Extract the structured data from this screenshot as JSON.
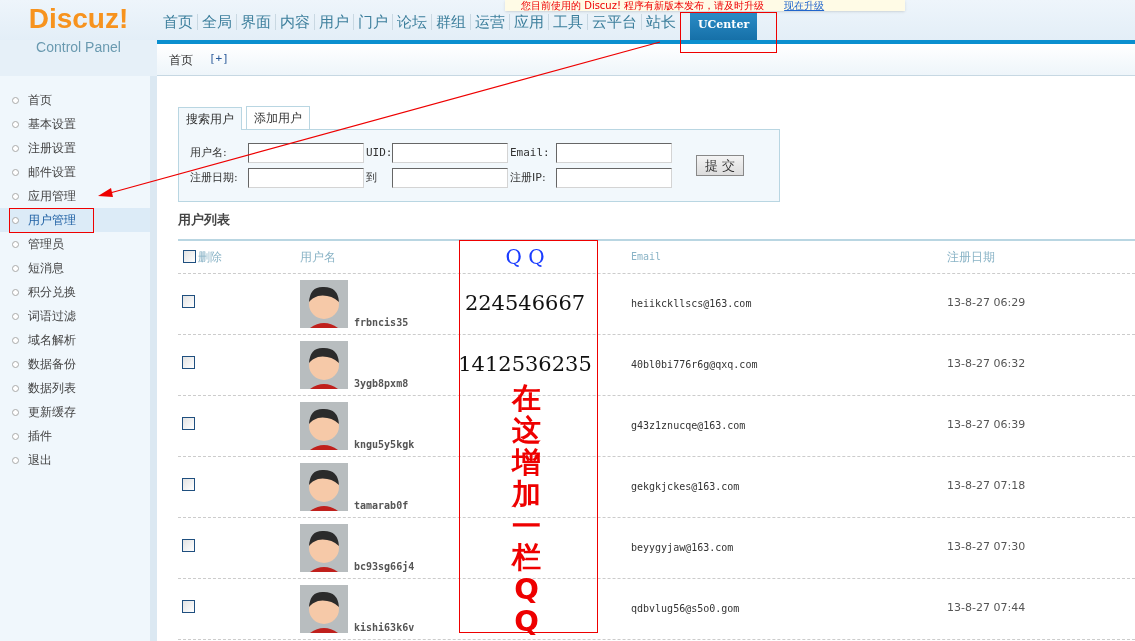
{
  "logo": {
    "title": "Discuz!",
    "subtitle": "Control Panel"
  },
  "notice": {
    "text": "您目前使用的 Discuz! 程序有新版本发布，请及时升级",
    "link": "现在升级"
  },
  "top_nav": [
    {
      "label": "首页",
      "selected": false
    },
    {
      "label": "全局",
      "selected": false
    },
    {
      "label": "界面",
      "selected": false
    },
    {
      "label": "内容",
      "selected": false
    },
    {
      "label": "用户",
      "selected": false
    },
    {
      "label": "门户",
      "selected": false
    },
    {
      "label": "论坛",
      "selected": false
    },
    {
      "label": "群组",
      "selected": false
    },
    {
      "label": "运营",
      "selected": false
    },
    {
      "label": "应用",
      "selected": false
    },
    {
      "label": "工具",
      "selected": false
    },
    {
      "label": "云平台",
      "selected": false
    },
    {
      "label": "站长",
      "selected": false
    },
    {
      "label": "UCenter",
      "selected": true
    }
  ],
  "breadcrumb": {
    "home": "首页",
    "add": "[+]"
  },
  "sidebar": {
    "items": [
      {
        "label": "首页",
        "selected": false
      },
      {
        "label": "基本设置",
        "selected": false
      },
      {
        "label": "注册设置",
        "selected": false
      },
      {
        "label": "邮件设置",
        "selected": false
      },
      {
        "label": "应用管理",
        "selected": false
      },
      {
        "label": "用户管理",
        "selected": true
      },
      {
        "label": "管理员",
        "selected": false
      },
      {
        "label": "短消息",
        "selected": false
      },
      {
        "label": "积分兑换",
        "selected": false
      },
      {
        "label": "词语过滤",
        "selected": false
      },
      {
        "label": "域名解析",
        "selected": false
      },
      {
        "label": "数据备份",
        "selected": false
      },
      {
        "label": "数据列表",
        "selected": false
      },
      {
        "label": "更新缓存",
        "selected": false
      },
      {
        "label": "插件",
        "selected": false
      },
      {
        "label": "退出",
        "selected": false
      }
    ]
  },
  "search_tabs": [
    {
      "label": "搜索用户",
      "selected": true
    },
    {
      "label": "添加用户",
      "selected": false
    }
  ],
  "search_fields": [
    {
      "label": "用户名:"
    },
    {
      "label": "UID:"
    },
    {
      "label": "Email:"
    },
    {
      "label": "注册日期:"
    },
    {
      "label": "到"
    },
    {
      "label": "注册IP:"
    }
  ],
  "submit": "提 交",
  "table": {
    "title": "用户列表",
    "select_all_checked": false,
    "columns": [
      "删除",
      "用户名",
      "Q Q",
      "Email",
      "注册日期"
    ],
    "rows": [
      {
        "checked": false,
        "username": "frbncis35",
        "qq": "224546667",
        "email": "heiikckllscs@163.com",
        "date": "13-8-27 06:29"
      },
      {
        "checked": false,
        "username": "3ygb8pxm8",
        "qq": "1412536235",
        "email": "40bl0bi776r6g@qxq.com",
        "date": "13-8-27 06:32"
      },
      {
        "checked": false,
        "username": "kngu5y5kgk",
        "email": "g43z1znucqe@163.com",
        "date": "13-8-27 06:39"
      },
      {
        "checked": false,
        "username": "tamarab0f",
        "email": "gekgkjckes@163.com",
        "date": "13-8-27 07:18"
      },
      {
        "checked": false,
        "username": "bc93sg66j4",
        "email": "beyygyjaw@163.com",
        "date": "13-8-27 07:30"
      },
      {
        "checked": false,
        "username": "kishi63k6v",
        "email": "qdbvlug56@s5o0.gom",
        "date": "13-8-27 07:44"
      }
    ]
  },
  "annotation": {
    "text": "在这增加一栏QQ"
  }
}
